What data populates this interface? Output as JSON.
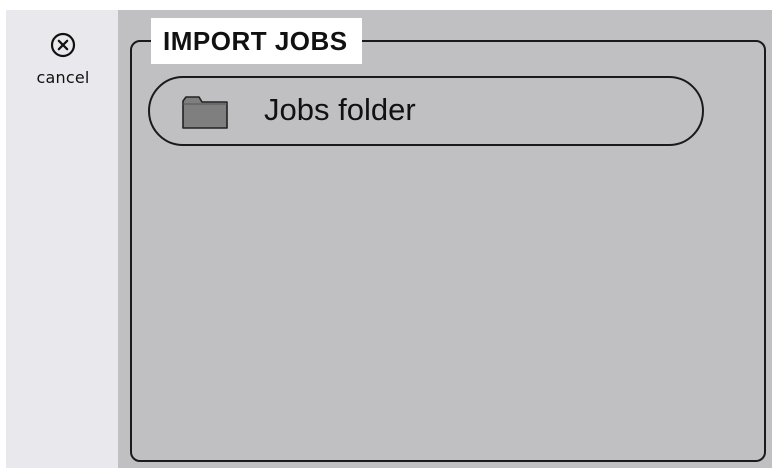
{
  "sidebar": {
    "cancel_label": "cancel",
    "cancel_icon": "circle-x-icon"
  },
  "panel": {
    "title": "IMPORT JOBS",
    "items": [
      {
        "label": "Jobs folder",
        "icon": "folder-icon"
      }
    ]
  },
  "colors": {
    "sidebar_bg": "#e9e9ed",
    "panel_bg": "#c0c0c2",
    "folder_fill": "#7f7f7f",
    "border": "#1a1a1a"
  }
}
